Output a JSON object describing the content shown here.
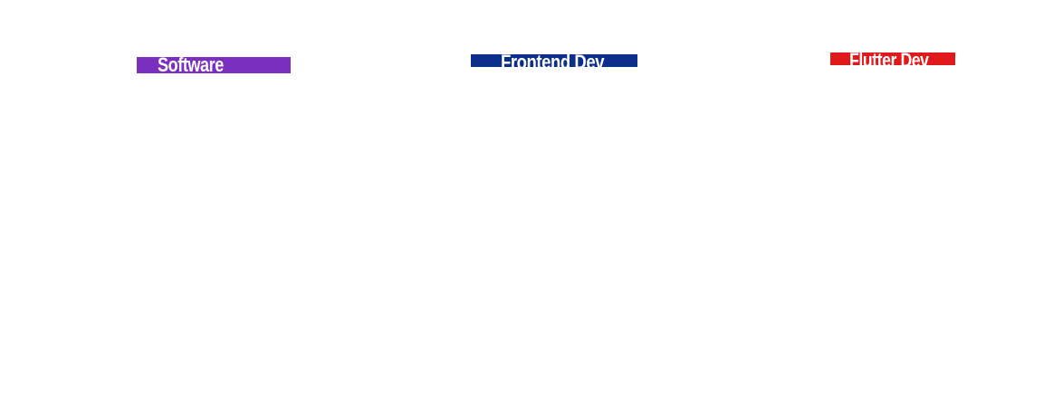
{
  "tags": [
    {
      "label": "Software",
      "color": "#7b2fbe"
    },
    {
      "label": "Frontend Dev",
      "color": "#0d2f8c"
    },
    {
      "label": "Flutter Dev",
      "color": "#e0191b"
    }
  ]
}
